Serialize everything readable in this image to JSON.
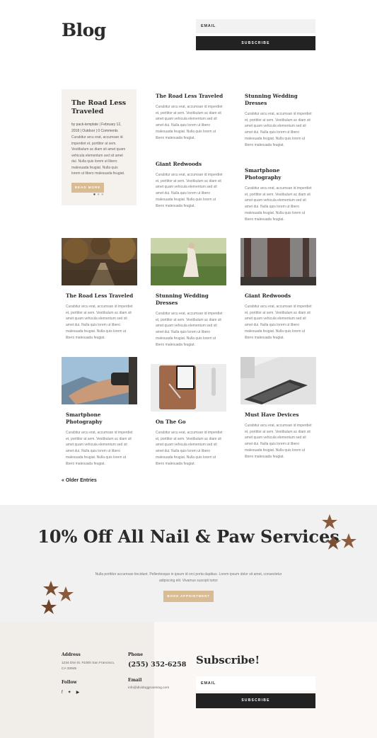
{
  "header": {
    "title": "Blog",
    "email_label": "EMAIL",
    "subscribe_label": "SUBSCRIBE"
  },
  "featured": {
    "title": "The Road Less Traveled",
    "meta": "by pack-template | February 12, 2018 | Outdoor | 0 Comments",
    "excerpt": "Curabitur arcu erat, accumsan id imperdiet et, porttitor at sem. Vestibulum ac diam sit amet quam vehicula elementum sed sit amet dui. Nulla quis lorem ut libero malesuada feugiat. Nulla quis lorem ut libero malesuada feugiat.",
    "read_more": "READ MORE"
  },
  "excerpt_text": "Curabitur arcu erat, accumsan id imperdiet et, porttitor at sem. Vestibulum ac diam sit amet quam vehicula elementum sed sit amet dui. Nulla quis lorem ut libero malesuada feugiat. Nulla quis lorem ut libero malesuada feugiat.",
  "top_posts": [
    {
      "title": "The Road Less Traveled"
    },
    {
      "title": "Stunning Wedding Dresses"
    },
    {
      "title": "Giant Redwoods"
    },
    {
      "title": "Smartphone Photography"
    }
  ],
  "grid_posts": [
    {
      "title": "The Road Less Traveled",
      "image": "forest-road"
    },
    {
      "title": "Stunning Wedding Dresses",
      "image": "bride-field"
    },
    {
      "title": "Giant Redwoods",
      "image": "redwood-trunk"
    },
    {
      "title": "Smartphone Photography",
      "image": "hands-binoculars"
    },
    {
      "title": "On The Go",
      "image": "phone-on-leather"
    },
    {
      "title": "Must Have Devices",
      "image": "laptop-keyboard"
    }
  ],
  "older_entries": "« Older Entries",
  "promo": {
    "title": "10% Off All Nail & Paw Services",
    "text": "Nulla porttitor accumsan tincidunt. Pellentesque in ipsum id orci porta dapibus. Lorem ipsum dolor sit amet, consectetur adipiscing elit. Vivamus suscipit tortor",
    "button": "BOOK APPOINTMENT"
  },
  "footer": {
    "address_label": "Address",
    "address": "1234 Divi St. #1000 San Francisco, CA 33945",
    "follow_label": "Follow",
    "phone_label": "Phone",
    "phone": "(255) 352-6258",
    "email_label": "Email",
    "email": "info@dividoggrooming.com",
    "subscribe_title": "Subscribe!",
    "email_field": "EMAIL",
    "subscribe_button": "SUBSCRIBE"
  },
  "colors": {
    "accent": "#d9bc93",
    "dark": "#222222",
    "promo_bg": "#f1f1f1"
  }
}
